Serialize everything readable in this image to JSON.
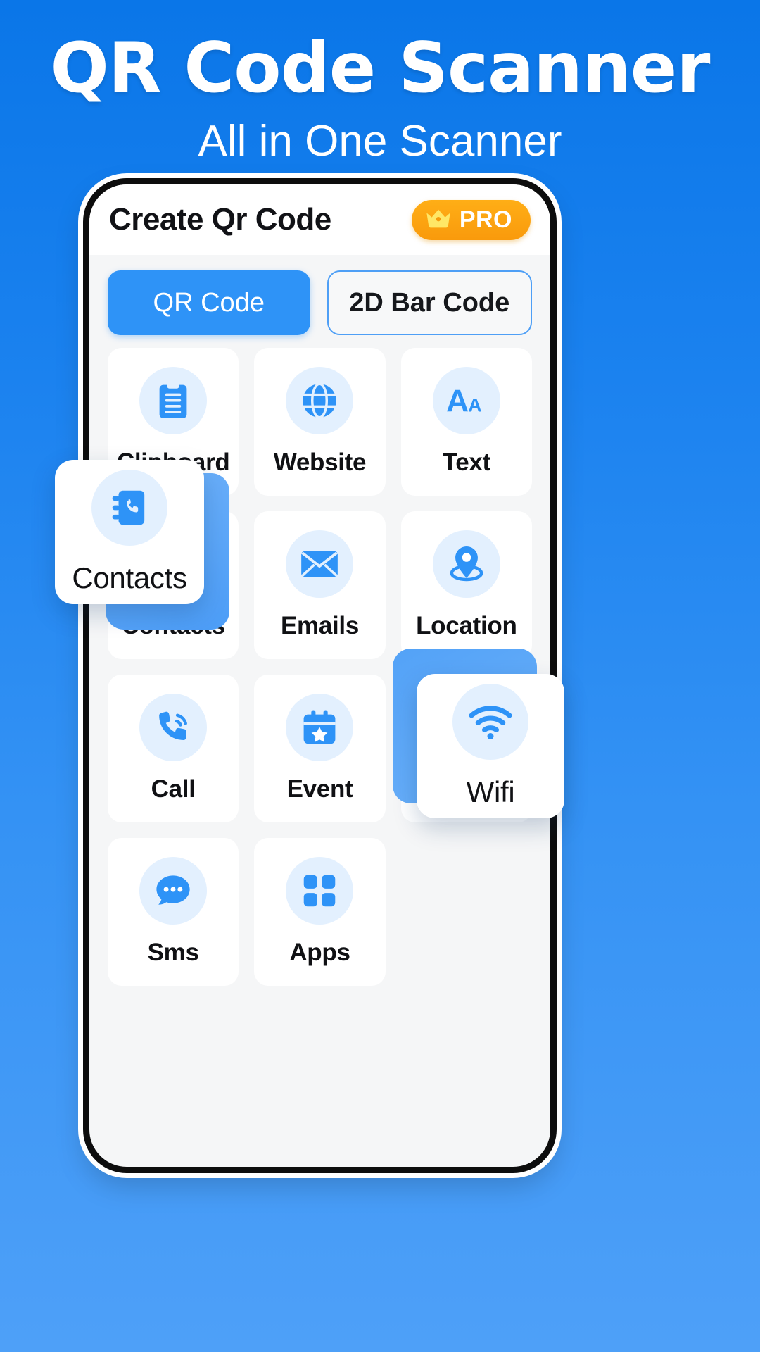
{
  "hero": {
    "title": "QR Code Scanner",
    "subtitle": "All in One Scanner"
  },
  "app": {
    "title": "Create Qr Code",
    "pro_badge": {
      "label": "PRO",
      "icon": "crown-icon",
      "color": "#fba016"
    },
    "tabs": [
      {
        "label": "QR Code",
        "active": true
      },
      {
        "label": "2D Bar Code",
        "active": false
      }
    ],
    "grid": [
      {
        "label": "Clipboard",
        "icon": "clipboard-icon"
      },
      {
        "label": "Website",
        "icon": "globe-icon"
      },
      {
        "label": "Text",
        "icon": "text-aa-icon"
      },
      {
        "label": "Contacts",
        "icon": "contacts-book-icon"
      },
      {
        "label": "Emails",
        "icon": "envelope-icon"
      },
      {
        "label": "Location",
        "icon": "map-pin-icon"
      },
      {
        "label": "Call",
        "icon": "phone-call-icon"
      },
      {
        "label": "Event",
        "icon": "calendar-star-icon"
      },
      {
        "label": "Wifi",
        "icon": "wifi-icon"
      },
      {
        "label": "Sms",
        "icon": "chat-bubble-icon"
      },
      {
        "label": "Apps",
        "icon": "grid-apps-icon"
      }
    ],
    "highlights": [
      {
        "label": "Contacts",
        "icon": "contacts-book-icon"
      },
      {
        "label": "Wifi",
        "icon": "wifi-icon"
      }
    ],
    "colors": {
      "accent": "#2e93f7",
      "icon_bg": "#e3f0fe",
      "screen_bg": "#f5f6f7",
      "card_bg": "#ffffff",
      "badge": "#fba016",
      "background_top": "#0a76e8",
      "background_bottom": "#4ea0f8"
    }
  }
}
